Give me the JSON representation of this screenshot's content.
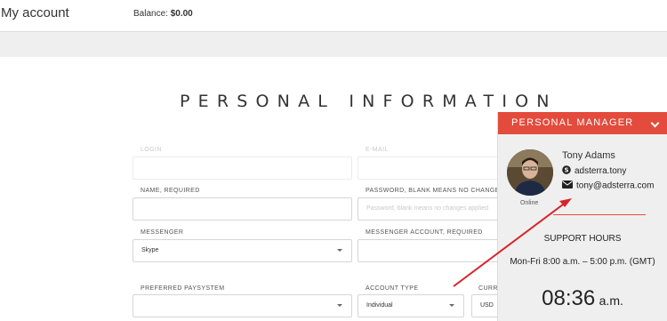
{
  "header": {
    "title": "My account",
    "balance_label": "Balance:",
    "balance_value": "$0.00"
  },
  "page": {
    "heading": "PERSONAL INFORMATION"
  },
  "form": {
    "login_label": "LOGIN",
    "email_label": "E-MAIL",
    "name_label": "NAME, REQUIRED",
    "password_label": "PASSWORD, BLANK MEANS NO CHANGES",
    "password_placeholder": "Password, blank means no changes applied",
    "messenger_label": "MESSENGER",
    "messenger_value": "Skype",
    "messenger_account_label": "MESSENGER ACCOUNT, REQUIRED",
    "paysystem_label": "PREFERRED PAYSYSTEM",
    "account_type_label": "ACCOUNT TYPE",
    "account_type_value": "Individual",
    "currency_label": "CURRENCY",
    "currency_value": "USD"
  },
  "manager": {
    "header": "PERSONAL MANAGER",
    "name": "Tony Adams",
    "skype": "adsterra.tony",
    "email": "tony@adsterra.com",
    "status": "Online",
    "support_title": "SUPPORT HOURS",
    "support_hours": "Mon-Fri 8:00 a.m. – 5:00 p.m. (GMT)",
    "time": "08:36",
    "ampm": "a.m."
  },
  "colors": {
    "accent": "#e34b3c",
    "arrow": "#d8232a"
  }
}
